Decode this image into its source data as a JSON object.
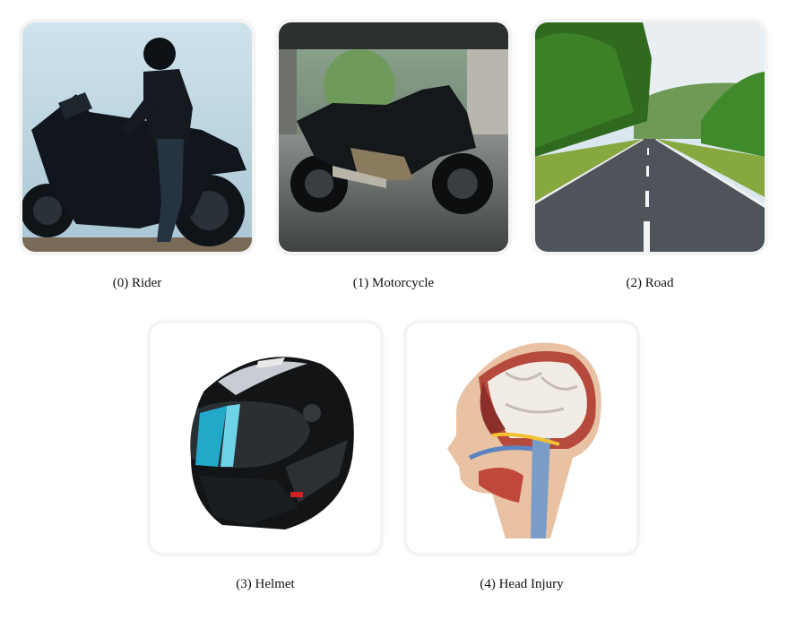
{
  "items": [
    {
      "index": 0,
      "caption": "(0) Rider",
      "subject": "motorcycle rider silhouette"
    },
    {
      "index": 1,
      "caption": "(1) Motorcycle",
      "subject": "black sport motorcycle"
    },
    {
      "index": 2,
      "caption": "(2) Road",
      "subject": "empty road through green trees"
    },
    {
      "index": 3,
      "caption": "(3) Helmet",
      "subject": "black full-face helmet with blue visor"
    },
    {
      "index": 4,
      "caption": "(4) Head Injury",
      "subject": "anatomical head cross-section"
    }
  ]
}
